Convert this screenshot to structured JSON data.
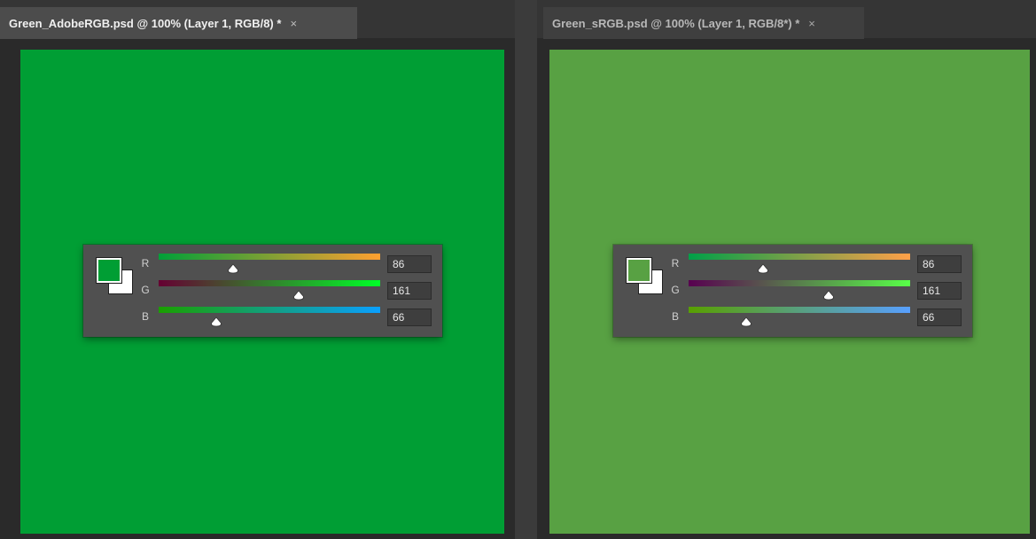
{
  "documents": [
    {
      "tab_title": "Green_AdobeRGB.psd @ 100% (Layer 1, RGB/8) *",
      "close_glyph": "×",
      "active": true,
      "canvas_color": "#009e34",
      "picker": {
        "foreground_color": "#009e34",
        "background_color": "#ffffff",
        "channels": [
          {
            "label": "R",
            "value": "86",
            "level": 0.337,
            "gradient": [
              "#00a038",
              "#ffa030"
            ]
          },
          {
            "label": "G",
            "value": "161",
            "level": 0.631,
            "gradient": [
              "#660032",
              "#00ff28"
            ]
          },
          {
            "label": "B",
            "value": "66",
            "level": 0.259,
            "gradient": [
              "#1aa000",
              "#0aa0ff"
            ]
          }
        ]
      }
    },
    {
      "tab_title": "Green_sRGB.psd @ 100% (Layer 1, RGB/8*) *",
      "close_glyph": "×",
      "active": false,
      "canvas_color": "#58a143",
      "picker": {
        "foreground_color": "#58a143",
        "background_color": "#ffffff",
        "channels": [
          {
            "label": "R",
            "value": "86",
            "level": 0.337,
            "gradient": [
              "#00a048",
              "#ffa048"
            ]
          },
          {
            "label": "G",
            "value": "161",
            "level": 0.631,
            "gradient": [
              "#580050",
              "#58ff48"
            ]
          },
          {
            "label": "B",
            "value": "66",
            "level": 0.259,
            "gradient": [
              "#58a000",
              "#58a0ff"
            ]
          }
        ]
      }
    }
  ]
}
